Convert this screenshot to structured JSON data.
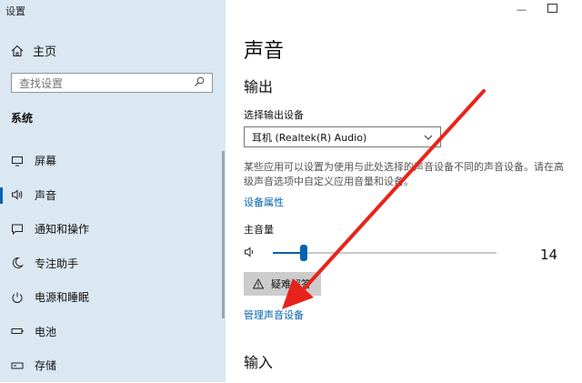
{
  "window": {
    "title": "设置"
  },
  "sidebar": {
    "home_label": "主页",
    "search_placeholder": "查找设置",
    "section_label": "系统",
    "items": [
      {
        "label": "屏幕",
        "icon": "monitor-icon"
      },
      {
        "label": "声音",
        "icon": "speaker-icon",
        "active": true
      },
      {
        "label": "通知和操作",
        "icon": "notification-icon"
      },
      {
        "label": "专注助手",
        "icon": "moon-icon"
      },
      {
        "label": "电源和睡眠",
        "icon": "power-icon"
      },
      {
        "label": "电池",
        "icon": "battery-icon"
      },
      {
        "label": "存储",
        "icon": "storage-icon"
      }
    ]
  },
  "main": {
    "title": "声音",
    "output_heading": "输出",
    "output_device_label": "选择输出设备",
    "output_device_value": "耳机 (Realtek(R) Audio)",
    "description": "某些应用可以设置为使用与此处选择的声音设备不同的声音设备。请在高级声音选项中自定义应用音量和设备。",
    "device_properties_link": "设备属性",
    "master_volume_label": "主音量",
    "volume_value": "14",
    "volume_fraction": 0.14,
    "troubleshoot_label": "疑难解答",
    "manage_devices_link": "管理声音设备",
    "input_heading": "输入"
  },
  "colors": {
    "sidebar_bg": "#dbe7f1",
    "accent": "#0063b1",
    "arrow": "#e8231b"
  }
}
